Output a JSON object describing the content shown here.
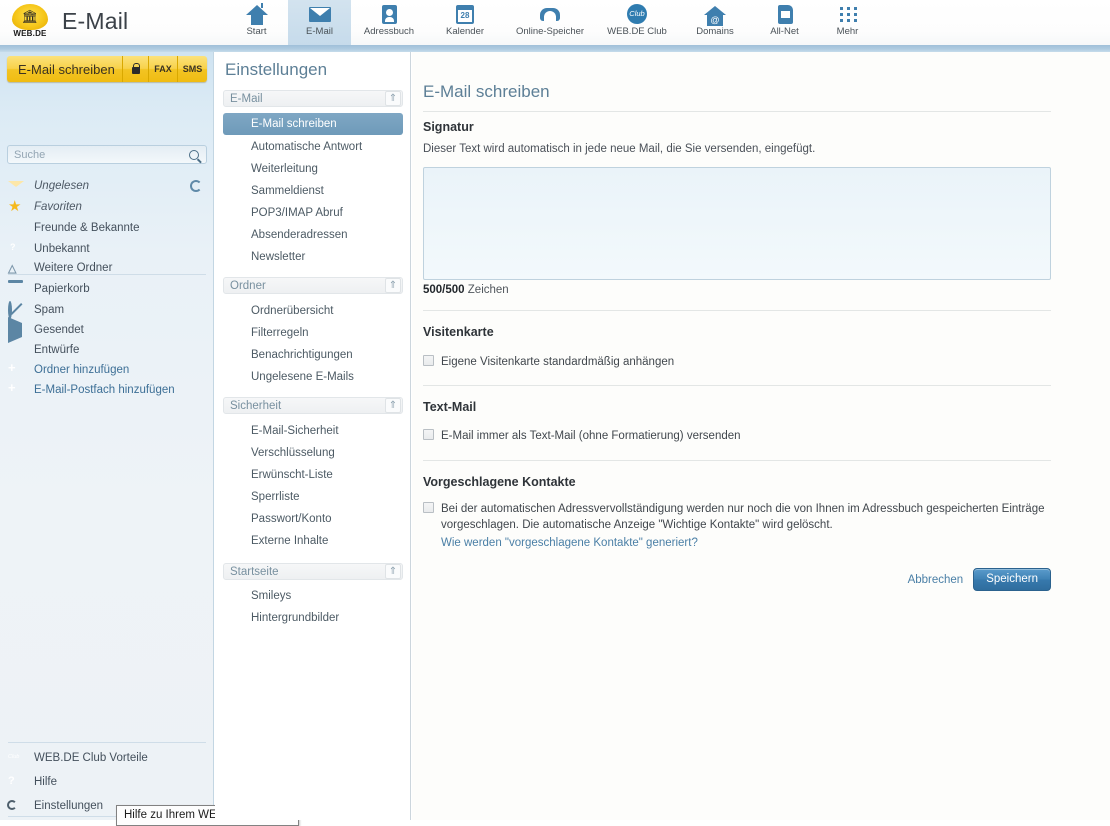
{
  "header": {
    "logo_text": "WEB.DE",
    "app_title": "E-Mail",
    "nav": [
      {
        "label": "Start",
        "icon": "home-icon",
        "active": false
      },
      {
        "label": "E-Mail",
        "icon": "mail-icon",
        "active": true
      },
      {
        "label": "Adressbuch",
        "icon": "address-book-icon",
        "active": false
      },
      {
        "label": "Kalender",
        "icon": "calendar-icon",
        "active": false
      },
      {
        "label": "Online-Speicher",
        "icon": "cloud-icon",
        "active": false
      },
      {
        "label": "WEB.DE Club",
        "icon": "club-icon",
        "active": false
      },
      {
        "label": "Domains",
        "icon": "domain-icon",
        "active": false
      },
      {
        "label": "All-Net",
        "icon": "sim-card-icon",
        "active": false
      },
      {
        "label": "Mehr",
        "icon": "grid-icon",
        "active": false
      }
    ]
  },
  "sidebar": {
    "compose_label": "E-Mail schreiben",
    "compose_lock_icon": "lock-icon",
    "compose_fax": "FAX",
    "compose_sms": "SMS",
    "search_placeholder": "Suche",
    "search_value": "",
    "folders": [
      {
        "label": "Ungelesen",
        "icon": "envelope-open-icon"
      },
      {
        "label": "Favoriten",
        "icon": "star-icon"
      },
      {
        "label": "Freunde & Bekannte",
        "icon": "envelope-icon"
      },
      {
        "label": "Unbekannt",
        "icon": "envelope-question-icon"
      },
      {
        "label": "Weitere Ordner",
        "icon": "chevron-up-icon"
      },
      {
        "label": "Papierkorb",
        "icon": "trash-icon"
      },
      {
        "label": "Spam",
        "icon": "ban-icon"
      },
      {
        "label": "Gesendet",
        "icon": "send-icon"
      },
      {
        "label": "Entwürfe",
        "icon": "pencil-icon"
      },
      {
        "label": "Ordner hinzufügen",
        "icon": "plus-icon"
      },
      {
        "label": "E-Mail-Postfach hinzufügen",
        "icon": "plus-icon"
      }
    ],
    "bottom_items": [
      {
        "label": "WEB.DE Club Vorteile",
        "icon": "club-icon"
      },
      {
        "label": "Hilfe",
        "icon": "help-icon"
      },
      {
        "label": "Einstellungen",
        "icon": "wrench-icon"
      }
    ],
    "tooltip": "Hilfe zu Ihrem WEB.DE Postfach"
  },
  "settings_nav": {
    "title": "Einstellungen",
    "sections": [
      {
        "label": "E-Mail",
        "toggle_icon": "double-chevron-up-icon",
        "items": [
          {
            "label": "E-Mail schreiben",
            "selected": true
          },
          {
            "label": "Automatische Antwort",
            "selected": false
          },
          {
            "label": "Weiterleitung",
            "selected": false
          },
          {
            "label": "Sammeldienst",
            "selected": false
          },
          {
            "label": "POP3/IMAP Abruf",
            "selected": false
          },
          {
            "label": "Absenderadressen",
            "selected": false
          },
          {
            "label": "Newsletter",
            "selected": false
          }
        ]
      },
      {
        "label": "Ordner",
        "toggle_icon": "double-chevron-up-icon",
        "items": [
          {
            "label": "Ordnerübersicht",
            "selected": false
          },
          {
            "label": "Filterregeln",
            "selected": false
          },
          {
            "label": "Benachrichtigungen",
            "selected": false
          },
          {
            "label": "Ungelesene E-Mails",
            "selected": false
          }
        ]
      },
      {
        "label": "Sicherheit",
        "toggle_icon": "double-chevron-up-icon",
        "items": [
          {
            "label": "E-Mail-Sicherheit",
            "selected": false
          },
          {
            "label": "Verschlüsselung",
            "selected": false
          },
          {
            "label": "Erwünscht-Liste",
            "selected": false
          },
          {
            "label": "Sperrliste",
            "selected": false
          },
          {
            "label": "Passwort/Konto",
            "selected": false
          },
          {
            "label": "Externe Inhalte",
            "selected": false
          }
        ]
      },
      {
        "label": "Startseite",
        "toggle_icon": "double-chevron-up-icon",
        "items": [
          {
            "label": "Smileys",
            "selected": false
          },
          {
            "label": "Hintergrundbilder",
            "selected": false
          }
        ]
      }
    ]
  },
  "main": {
    "page_title": "E-Mail schreiben",
    "signature": {
      "heading": "Signatur",
      "description": "Dieser Text wird automatisch in jede neue Mail, die Sie versenden, eingefügt.",
      "value": "",
      "counter_number": "500/500",
      "counter_unit": "Zeichen"
    },
    "visitenkarte": {
      "heading": "Visitenkarte",
      "checkbox_label": "Eigene Visitenkarte standardmäßig anhängen",
      "checked": false
    },
    "textmail": {
      "heading": "Text-Mail",
      "checkbox_label": "E-Mail immer als Text-Mail (ohne Formatierung) versenden",
      "checked": false
    },
    "kontakte": {
      "heading": "Vorgeschlagene Kontakte",
      "checkbox_label_line1": "Bei der automatischen Adressvervollständigung werden nur noch die von Ihnen im Adressbuch gespeicherten Einträge",
      "checkbox_label_line2": "vorgeschlagen. Die automatische Anzeige \"Wichtige Kontakte\" wird gelöscht.",
      "checked": false,
      "help_link": "Wie werden \"vorgeschlagene Kontakte\" generiert?"
    },
    "cancel_label": "Abbrechen",
    "save_label": "Speichern"
  },
  "colors": {
    "accent_blue": "#3f7fae",
    "brand_yellow": "#f2c423",
    "selected_nav": "#6e9ab9",
    "title_blue": "#5d7f96"
  }
}
